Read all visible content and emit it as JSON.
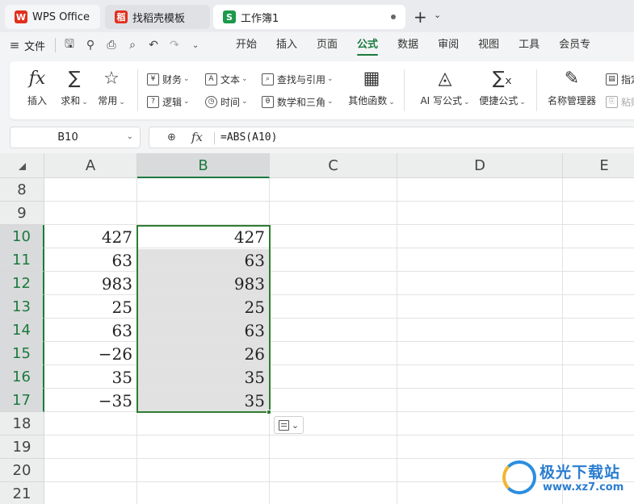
{
  "tabs": [
    {
      "label": "WPS Office",
      "icon": "wps-logo-icon",
      "color": "#e0301e"
    },
    {
      "label": "找稻壳模板",
      "icon": "docer-icon",
      "color": "#e0301e"
    },
    {
      "label": "工作簿1",
      "icon": "spreadsheet-icon",
      "icon_letter": "S",
      "color": "#1b9a4b"
    }
  ],
  "menubar": {
    "file_label": "文件",
    "tabs": [
      "开始",
      "插入",
      "页面",
      "公式",
      "数据",
      "审阅",
      "视图",
      "工具",
      "会员专"
    ],
    "active_tab": "公式"
  },
  "ribbon": {
    "insert_label": "插入",
    "sum_label": "求和",
    "common_label": "常用",
    "finance_label": "财务",
    "text_label": "文本",
    "lookup_label": "查找与引用",
    "logic_label": "逻辑",
    "time_label": "时间",
    "math_label": "数学和三角",
    "other_label": "其他函数",
    "ai_label": "AI 写公式",
    "quick_label": "便捷公式",
    "name_mgr_label": "名称管理器",
    "specify_label": "指定",
    "paste_label": "粘贴"
  },
  "formula_bar": {
    "name_box": "B10",
    "fx": "fx",
    "formula": "=ABS(A10)"
  },
  "grid": {
    "columns": [
      "A",
      "B",
      "C",
      "D",
      "E"
    ],
    "selected_column": "B",
    "rows": [
      {
        "n": "8",
        "a": "",
        "b": ""
      },
      {
        "n": "9",
        "a": "",
        "b": ""
      },
      {
        "n": "10",
        "a": "427",
        "b": "427"
      },
      {
        "n": "11",
        "a": "63",
        "b": "63"
      },
      {
        "n": "12",
        "a": "983",
        "b": "983"
      },
      {
        "n": "13",
        "a": "25",
        "b": "25"
      },
      {
        "n": "14",
        "a": "63",
        "b": "63"
      },
      {
        "n": "15",
        "a": "−26",
        "b": "26"
      },
      {
        "n": "16",
        "a": "35",
        "b": "35"
      },
      {
        "n": "17",
        "a": "−35",
        "b": "35"
      },
      {
        "n": "18",
        "a": "",
        "b": ""
      },
      {
        "n": "19",
        "a": "",
        "b": ""
      },
      {
        "n": "20",
        "a": "",
        "b": ""
      },
      {
        "n": "21",
        "a": "",
        "b": ""
      }
    ],
    "selected_rows": [
      "10",
      "11",
      "12",
      "13",
      "14",
      "15",
      "16",
      "17"
    ],
    "accent_color": "#1b7a3e"
  },
  "watermark": {
    "title": "极光下载站",
    "url": "www.xz7.com"
  }
}
